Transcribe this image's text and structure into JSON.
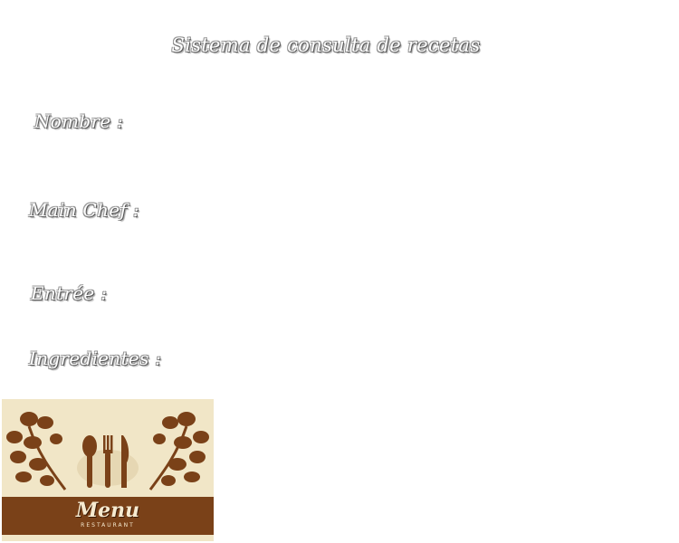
{
  "page": {
    "title": "Sistema de consulta de recetas"
  },
  "form": {
    "nombre_label": "Nombre :",
    "main_chef_label": "Main Chef :",
    "entree_label": "Entrée :",
    "ingredientes_label": "Ingredientes :"
  },
  "menu_card": {
    "title": "Menu",
    "subtitle": "RESTAURANT",
    "colors": {
      "background": "#f1e6c7",
      "brown": "#7a4118"
    },
    "icon": "cutlery-icon"
  }
}
